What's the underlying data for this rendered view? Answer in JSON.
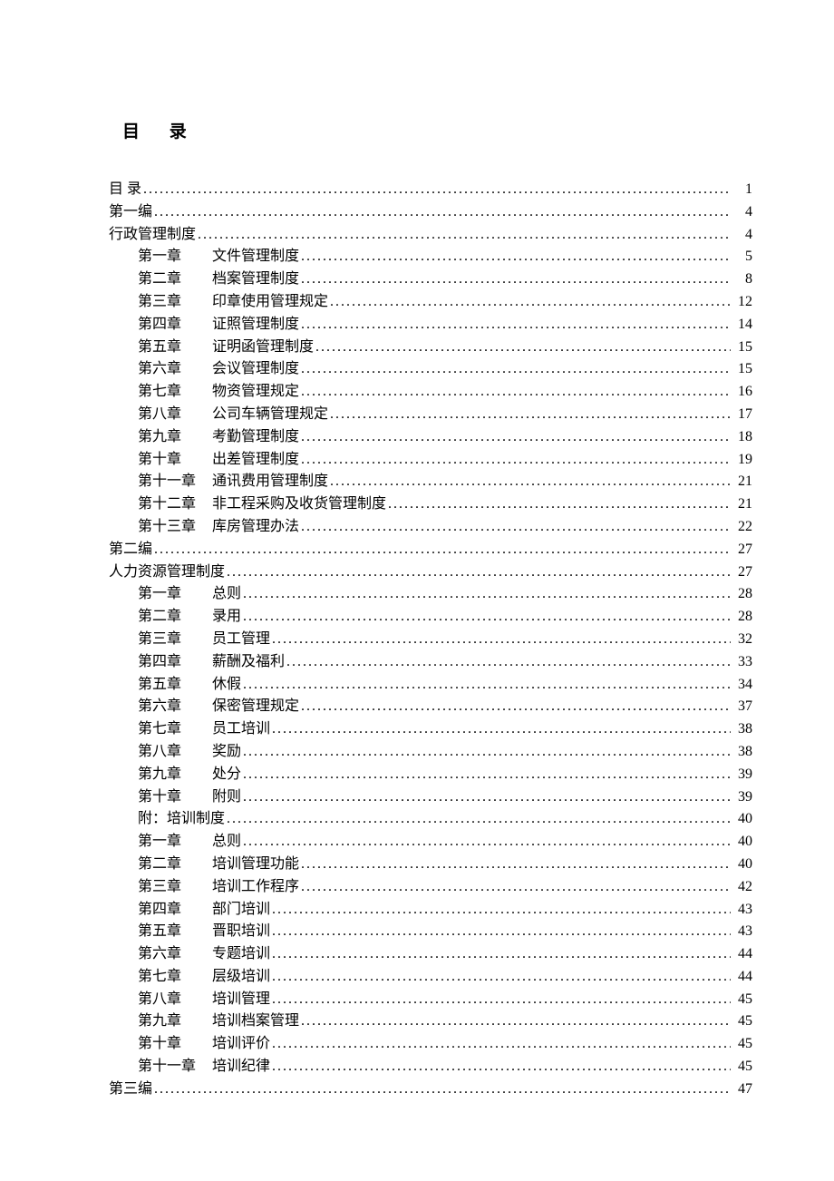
{
  "title": "目 录",
  "entries": [
    {
      "indent": 0,
      "label": "",
      "title": "目   录",
      "page": "1"
    },
    {
      "indent": 0,
      "label": "",
      "title": "第一编",
      "page": "4"
    },
    {
      "indent": 0,
      "label": "",
      "title": "行政管理制度",
      "page": "4"
    },
    {
      "indent": 1,
      "label": "第一章",
      "title": "文件管理制度",
      "page": "5"
    },
    {
      "indent": 1,
      "label": "第二章",
      "title": "档案管理制度",
      "page": "8"
    },
    {
      "indent": 1,
      "label": "第三章",
      "title": "印章使用管理规定",
      "page": "12"
    },
    {
      "indent": 1,
      "label": "第四章",
      "title": "证照管理制度",
      "page": "14"
    },
    {
      "indent": 1,
      "label": "第五章",
      "title": "证明函管理制度",
      "page": "15"
    },
    {
      "indent": 1,
      "label": "第六章",
      "title": "会议管理制度",
      "page": "15"
    },
    {
      "indent": 1,
      "label": "第七章",
      "title": "物资管理规定",
      "page": "16"
    },
    {
      "indent": 1,
      "label": "第八章",
      "title": "公司车辆管理规定",
      "page": "17"
    },
    {
      "indent": 1,
      "label": "第九章",
      "title": " 考勤管理制度",
      "page": "18"
    },
    {
      "indent": 1,
      "label": "第十章",
      "title": "出差管理制度",
      "page": "19"
    },
    {
      "indent": 1,
      "label": "第十一章",
      "title": " 通讯费用管理制度",
      "page": "21"
    },
    {
      "indent": 1,
      "label": "第十二章",
      "title": " 非工程采购及收货管理制度",
      "page": "21"
    },
    {
      "indent": 1,
      "label": "第十三章",
      "title": " 库房管理办法",
      "page": "22"
    },
    {
      "indent": 0,
      "label": "",
      "title": "第二编",
      "page": "27"
    },
    {
      "indent": 0,
      "label": "",
      "title": "人力资源管理制度",
      "page": "27"
    },
    {
      "indent": 1,
      "label": "第一章",
      "title": "总则",
      "page": "28"
    },
    {
      "indent": 1,
      "label": "第二章",
      "title": "录用",
      "page": "28"
    },
    {
      "indent": 1,
      "label": "第三章",
      "title": "员工管理",
      "page": "32"
    },
    {
      "indent": 1,
      "label": "第四章",
      "title": "薪酬及福利",
      "page": "33"
    },
    {
      "indent": 1,
      "label": "第五章",
      "title": "休假",
      "page": "34"
    },
    {
      "indent": 1,
      "label": "第六章",
      "title": "保密管理规定",
      "page": "37"
    },
    {
      "indent": 1,
      "label": "第七章",
      "title": "员工培训",
      "page": "38"
    },
    {
      "indent": 1,
      "label": "第八章",
      "title": "奖励",
      "page": "38"
    },
    {
      "indent": 1,
      "label": "第九章",
      "title": "处分",
      "page": "39"
    },
    {
      "indent": 1,
      "label": "第十章",
      "title": "附则",
      "page": "39"
    },
    {
      "indent": 1,
      "label": "",
      "title": "附：培训制度",
      "page": "40"
    },
    {
      "indent": 1,
      "label": "第一章",
      "title": "总则",
      "page": "40"
    },
    {
      "indent": 1,
      "label": "第二章",
      "title": "培训管理功能",
      "page": "40"
    },
    {
      "indent": 1,
      "label": "第三章",
      "title": "培训工作程序",
      "page": "42"
    },
    {
      "indent": 1,
      "label": "第四章",
      "title": "部门培训",
      "page": "43"
    },
    {
      "indent": 1,
      "label": "第五章",
      "title": "晋职培训",
      "page": "43"
    },
    {
      "indent": 1,
      "label": "第六章",
      "title": "专题培训",
      "page": "44"
    },
    {
      "indent": 1,
      "label": "第七章",
      "title": "层级培训",
      "page": "44"
    },
    {
      "indent": 1,
      "label": "第八章",
      "title": "培训管理",
      "page": "45"
    },
    {
      "indent": 1,
      "label": "第九章",
      "title": "培训档案管理",
      "page": "45"
    },
    {
      "indent": 1,
      "label": "第十章",
      "title": "培训评价",
      "page": "45"
    },
    {
      "indent": 1,
      "label": "第十一章",
      "title": " 培训纪律",
      "page": "45"
    },
    {
      "indent": 0,
      "label": "",
      "title": "第三编",
      "page": "47"
    }
  ]
}
